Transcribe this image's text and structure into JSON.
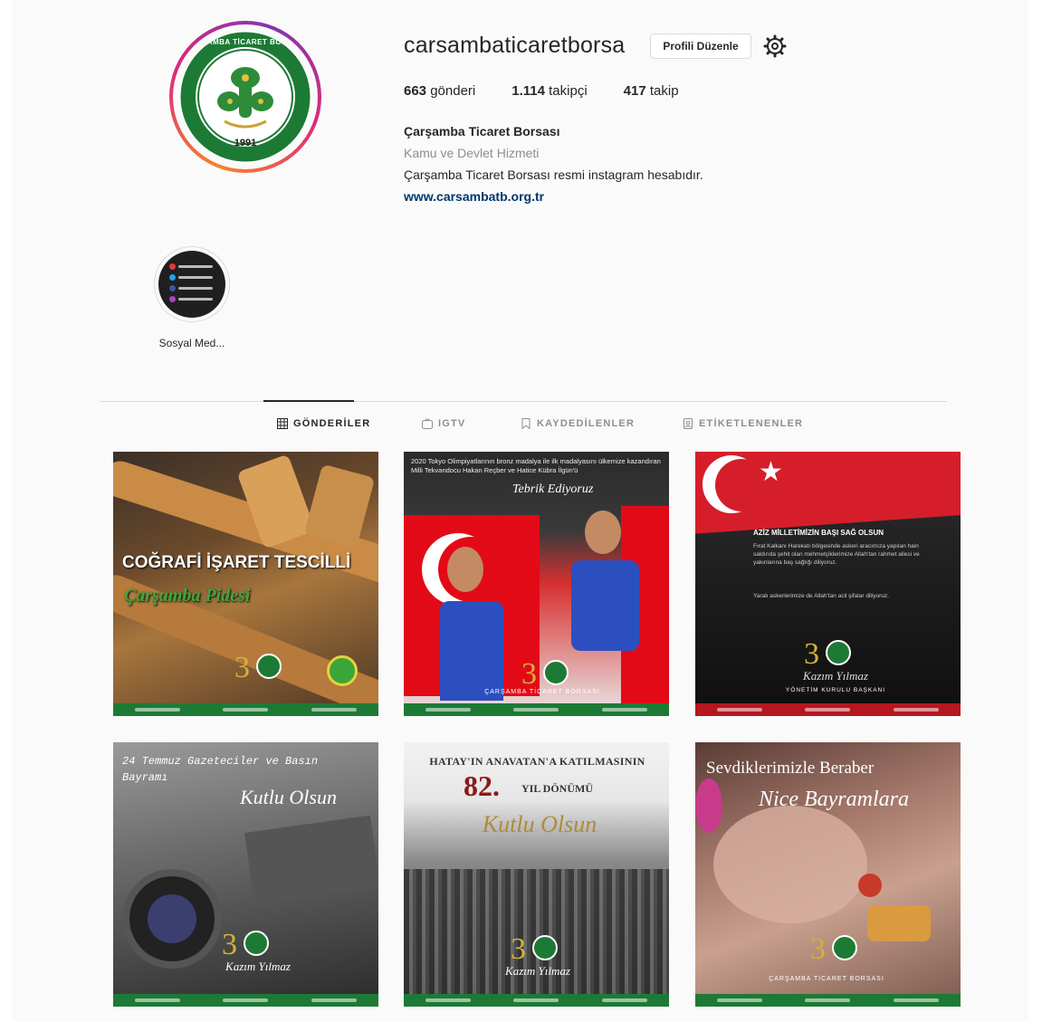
{
  "profile": {
    "username": "carsambaticaretborsa",
    "edit_label": "Profili Düzenle",
    "posts_count": "663",
    "posts_label": "gönderi",
    "followers_count": "1.114",
    "followers_label": "takipçi",
    "following_count": "417",
    "following_label": "takip",
    "full_name": "Çarşamba Ticaret Borsası",
    "category": "Kamu ve Devlet Hizmeti",
    "bio": "Çarşamba Ticaret Borsası resmi instagram hesabıdır.",
    "website": "www.carsambatb.org.tr",
    "logo_text_top": "ÇARŞAMBA TİCARET BORSASI",
    "logo_year": "1991"
  },
  "highlights": [
    {
      "label": "Sosyal Med..."
    }
  ],
  "tabs": [
    {
      "label": "GÖNDERİLER",
      "icon": "grid-icon"
    },
    {
      "label": "IGTV",
      "icon": "igtv-icon"
    },
    {
      "label": "KAYDEDİLENLER",
      "icon": "bookmark-icon"
    },
    {
      "label": "ETİKETLENENLER",
      "icon": "tag-icon"
    }
  ],
  "posts": [
    {
      "headline": "COĞRAFİ İŞARET TESCİLLİ",
      "subline": "Çarşamba Pidesi"
    },
    {
      "headline": "2020 Tokyo Olimpiyatlarının bronz madalya ile ilk madalyasını ülkemize kazandıran Milli Tekvandocu Hakan Reçber ve Hatice Kübra İlgün'ü",
      "subline": "Tebrik Ediyoruz",
      "footer_text": "ÇARŞAMBA TİCARET BORSASI"
    },
    {
      "headline": "AZİZ MİLLETİMİZİN BAŞI SAĞ OLSUN",
      "subline": "Fırat Kalkanı Harekatı bölgesinde askeri aracımıza yapılan hain saldırıda şehit olan mehmetçiklerimize Allah'tan rahmet ailesi ve yakınlarına baş sağlığı diliyoruz.",
      "note": "Yaralı askerlerimize de Allah'tan acil şifalar diliyoruz.",
      "sign": "Kazım Yılmaz",
      "sign_title": "YÖNETİM KURULU BAŞKANI"
    },
    {
      "headline": "24 Temmuz Gazeteciler ve Basın Bayramı",
      "subline": "Kutlu Olsun",
      "sign": "Kazım Yılmaz"
    },
    {
      "headline": "HATAY'IN ANAVATAN'A KATILMASININ",
      "number": "82.",
      "number_label": "YIL DÖNÜMÜ",
      "subline": "Kutlu Olsun",
      "sign": "Kazım Yılmaz"
    },
    {
      "headline": "Sevdiklerimizle Beraber",
      "subline": "Nice Bayramlara",
      "footer_text": "ÇARŞAMBA TİCARET BORSASI"
    }
  ],
  "colors": {
    "accent_green": "#1d7a34",
    "link": "#00376b",
    "turkish_red": "#e30a17"
  }
}
